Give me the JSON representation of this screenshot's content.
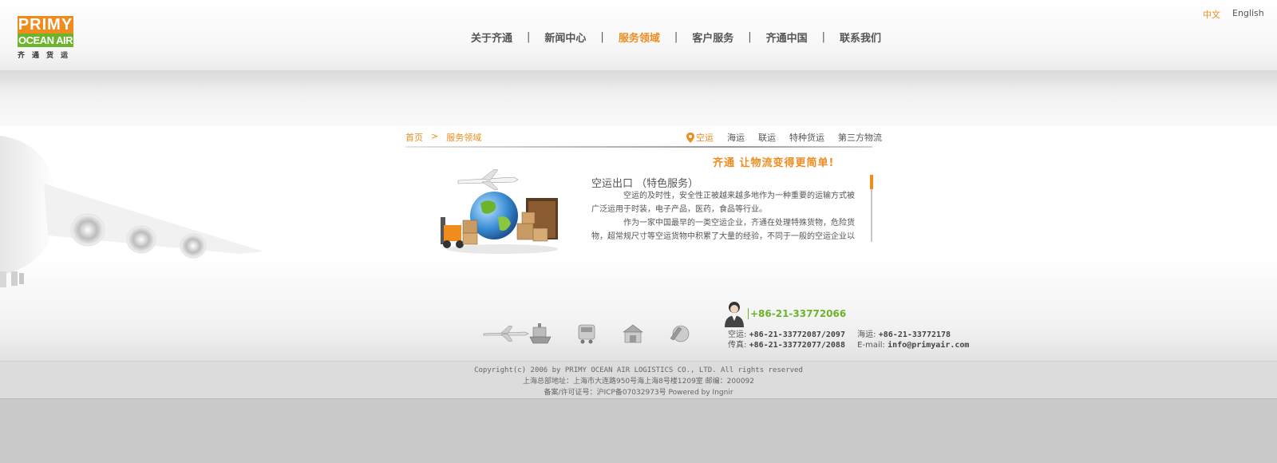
{
  "header": {
    "logo": {
      "top": "PRIMY",
      "middle": "OCEAN AIR",
      "cn": "齐通货运"
    },
    "lang": {
      "cn": "中文",
      "en": "English"
    },
    "nav": [
      {
        "label": "关于齐通"
      },
      {
        "label": "新闻中心"
      },
      {
        "label": "服务领域",
        "active": true
      },
      {
        "label": "客户服务"
      },
      {
        "label": "齐通中国"
      },
      {
        "label": "联系我们"
      }
    ],
    "nav_separator": "|"
  },
  "breadcrumb": {
    "home": "首页",
    "sep": ">",
    "current": "服务领域"
  },
  "subnav": [
    "空运",
    "海运",
    "联运",
    "特种货运",
    "第三方物流"
  ],
  "slogan": "齐通  让物流变得更简单!",
  "content": {
    "title": "空运出口  （特色服务）",
    "paragraphs": [
      "空运的及时性，安全性正被越来越多地作为一种重要的运输方式被广泛运用于时装，电子产品，医药，食品等行业。",
      "作为一家中国最早的一类空运企业，齐通在处理特殊货物，危险货物，超常规尺寸等空运货物中积累了大量的经验，不同于一般的空运企业以"
    ]
  },
  "contact": {
    "hotline": "+86-21-33772066",
    "air_label": "空运:",
    "air_value": "+86-21-33772087/2097",
    "sea_label": "海运:",
    "sea_value": "+86-21-33772178",
    "fax_label": "传真:",
    "fax_value": "+86-21-33772077/2088",
    "email_label": "E-mail:",
    "email_value": "info@primyair.com"
  },
  "footer": {
    "copyright": "Copyright(c) 2006 by PRIMY OCEAN AIR LOGISTICS CO., LTD. All rights reserved",
    "address": "上海总部地址：上海市大连路950号海上海8号楼1209室 邮编：200092",
    "icp": "备案/许可证号：沪ICP备07032973号 Powered by Ingnir"
  },
  "colors": {
    "accent": "#f08c1e",
    "green": "#6cb42c"
  },
  "icons": [
    "airplane-icon",
    "ship-icon",
    "train-icon",
    "warehouse-icon",
    "globe-icon"
  ]
}
